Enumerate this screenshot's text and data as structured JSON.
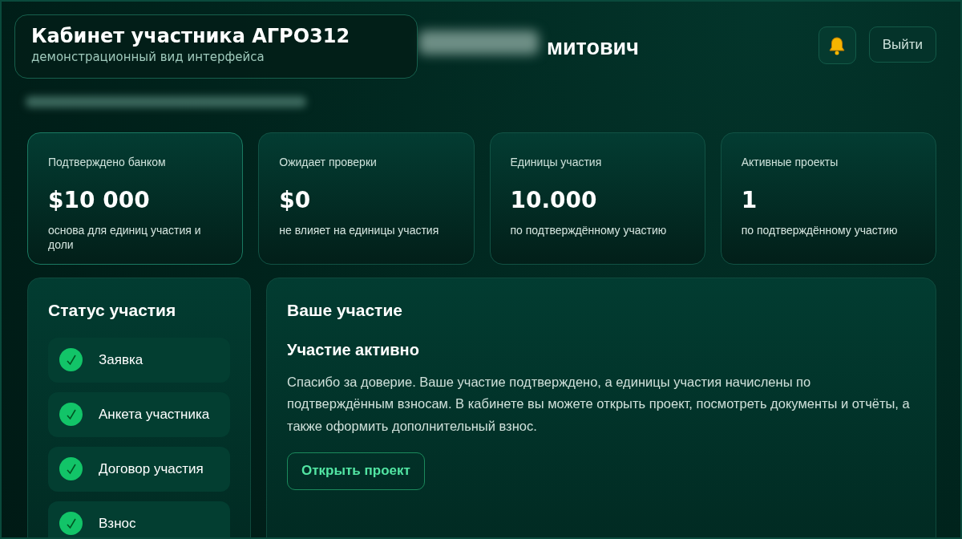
{
  "overlay": {
    "title": "Кабинет участника АГРО312",
    "subtitle": "демонстрационный вид интерфейса"
  },
  "header": {
    "name_visible": "митович",
    "logout": "Выйти"
  },
  "stats": [
    {
      "label": "Подтверждено банком",
      "value": "$10 000",
      "note": "основа для единиц участия и доли",
      "highlight": true
    },
    {
      "label": "Ожидает проверки",
      "value": "$0",
      "note": "не влияет на единицы участия",
      "highlight": false
    },
    {
      "label": "Единицы участия",
      "value": "10.000",
      "note": "по подтверждённому участию",
      "highlight": false
    },
    {
      "label": "Активные проекты",
      "value": "1",
      "note": "по подтверждённому участию",
      "highlight": false
    }
  ],
  "status": {
    "title": "Статус участия",
    "steps": [
      {
        "label": "Заявка",
        "done": true
      },
      {
        "label": "Анкета участника",
        "done": true
      },
      {
        "label": "Договор участия",
        "done": true
      },
      {
        "label": "Взнос",
        "done": true
      }
    ]
  },
  "participation": {
    "title": "Ваше участие",
    "subtitle": "Участие активно",
    "text": "Спасибо за доверие. Ваше участие подтверждено, а единицы участия начислены по подтверждённым взносам. В кабинете вы можете открыть проект, посмотреть документы и отчёты, а также оформить дополнительный взнос.",
    "button": "Открыть проект"
  }
}
